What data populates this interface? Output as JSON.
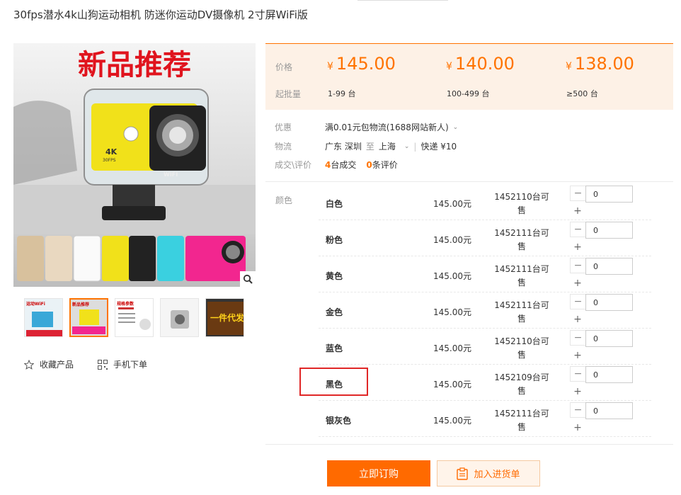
{
  "product": {
    "title": "30fps潜水4k山狗运动相机 防迷你运动DV摄像机 2寸屏WiFi版",
    "banner_text": "新品推荐",
    "camera_badge_4k": "4K",
    "camera_badge_30fps": "30FPS",
    "camera_wifi": "WIFI"
  },
  "gallery": {
    "thumbs": [
      {
        "label": "运动WiFi"
      },
      {
        "label": "新品推荐"
      },
      {
        "label": "规格参数"
      },
      {
        "label": ""
      },
      {
        "label": "一件代发"
      }
    ]
  },
  "actions": {
    "favorite_label": "收藏产品",
    "mobile_order_label": "手机下单"
  },
  "pricing": {
    "price_label": "价格",
    "batch_label": "起批量",
    "currency": "¥",
    "tiers": [
      {
        "price": "145.00",
        "range": "1-99 台"
      },
      {
        "price": "140.00",
        "range": "100-499 台"
      },
      {
        "price": "138.00",
        "range": "≥500 台"
      }
    ],
    "accent_color": "#ff7300"
  },
  "promo": {
    "label": "优惠",
    "text": "满0.01元包物流(1688网站新人)"
  },
  "shipping": {
    "label": "物流",
    "from": "广东 深圳",
    "to_word": "至",
    "to": "上海",
    "method": "快递 ¥10"
  },
  "deals": {
    "label": "成交\\评价",
    "sold_count": "4",
    "sold_text": "台成交",
    "review_count": "0",
    "review_text": "条评价"
  },
  "sku": {
    "color_label": "颜色",
    "rows": [
      {
        "name": "白色",
        "price": "145.00元",
        "stock": "1452110台可售",
        "qty": "0"
      },
      {
        "name": "粉色",
        "price": "145.00元",
        "stock": "1452111台可售",
        "qty": "0"
      },
      {
        "name": "黄色",
        "price": "145.00元",
        "stock": "1452111台可售",
        "qty": "0"
      },
      {
        "name": "金色",
        "price": "145.00元",
        "stock": "1452111台可售",
        "qty": "0"
      },
      {
        "name": "蓝色",
        "price": "145.00元",
        "stock": "1452110台可售",
        "qty": "0"
      },
      {
        "name": "黑色",
        "price": "145.00元",
        "stock": "1452109台可售",
        "qty": "0"
      },
      {
        "name": "银灰色",
        "price": "145.00元",
        "stock": "1452111台可售",
        "qty": "0"
      }
    ],
    "highlight_color": "#e02727"
  },
  "buttons": {
    "buy_now": "立即订购",
    "add_to_list": "加入进货单"
  }
}
